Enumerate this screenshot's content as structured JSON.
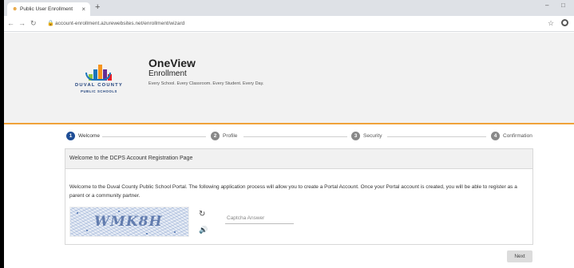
{
  "browser": {
    "tab_title": "Public User Enrollment",
    "tab_close": "×",
    "new_tab": "+",
    "url": "account-enrollment.azurewebsites.net/enrollment/wizard",
    "minimize": "–",
    "maximize": "□"
  },
  "header": {
    "logo_text": "DUVAL COUNTY",
    "logo_subtext": "PUBLIC SCHOOLS",
    "brand_title": "OneView",
    "brand_subtitle": "Enrollment",
    "tagline": "Every School. Every Classroom. Every Student. Every Day."
  },
  "stepper": {
    "steps": [
      {
        "number": "1",
        "label": "Welcome",
        "active": true
      },
      {
        "number": "2",
        "label": "Profile",
        "active": false
      },
      {
        "number": "3",
        "label": "Security",
        "active": false
      },
      {
        "number": "4",
        "label": "Confirmation",
        "active": false
      }
    ],
    "active_color": "#1f4e96",
    "inactive_color": "#888888"
  },
  "card": {
    "heading": "Welcome to the DCPS Account Registration Page",
    "intro": "Welcome to the Duval County Public School Portal. The following application process will allow you to create a Portal Account. Once your Portal account is created, you will be able to register as a parent or a community partner.",
    "captcha_text": "WMK8H",
    "captcha_placeholder": "Captcha Answer"
  },
  "actions": {
    "next_label": "Next"
  },
  "colors": {
    "accent_orange": "#f0a23a",
    "logo_colors": [
      "#8cc63f",
      "#1b75bb",
      "#f7941d",
      "#662d91",
      "#ed1c24"
    ]
  }
}
